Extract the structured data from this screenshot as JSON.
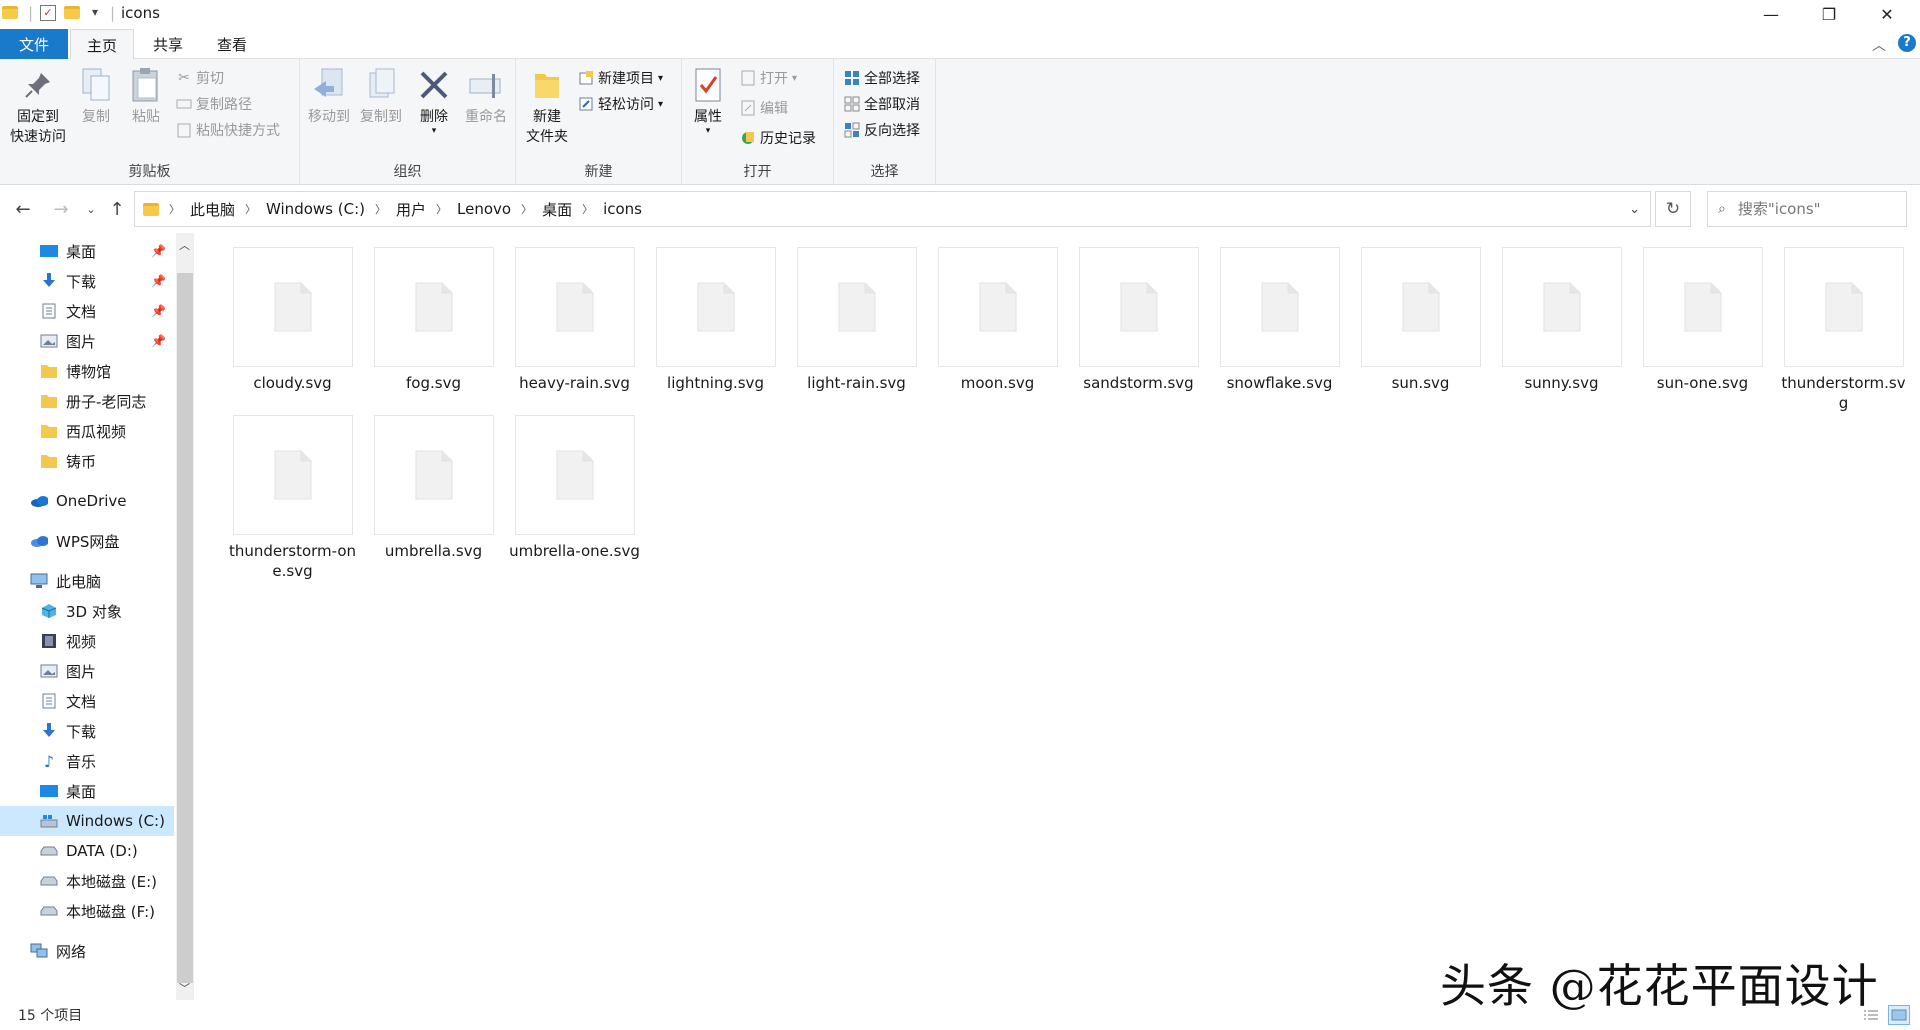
{
  "window": {
    "title": "icons",
    "minimize": "—",
    "maximize": "❐",
    "close": "✕"
  },
  "tabs": [
    {
      "label": "文件"
    },
    {
      "label": "主页"
    },
    {
      "label": "共享"
    },
    {
      "label": "查看"
    }
  ],
  "ribbon": {
    "clipboard": {
      "pin": "固定到\n快速访问",
      "pin_line1": "固定到",
      "pin_line2": "快速访问",
      "copy": "复制",
      "paste": "粘贴",
      "cut": "剪切",
      "copy_path": "复制路径",
      "paste_shortcut": "粘贴快捷方式",
      "label": "剪贴板"
    },
    "organize": {
      "move_to": "移动到",
      "copy_to": "复制到",
      "delete": "删除",
      "rename": "重命名",
      "label": "组织"
    },
    "new": {
      "new_folder_line1": "新建",
      "new_folder_line2": "文件夹",
      "new_item": "新建项目",
      "easy_access": "轻松访问",
      "label": "新建"
    },
    "open": {
      "properties": "属性",
      "open": "打开",
      "edit": "编辑",
      "history": "历史记录",
      "label": "打开"
    },
    "select": {
      "select_all": "全部选择",
      "select_none": "全部取消",
      "invert": "反向选择",
      "label": "选择"
    }
  },
  "breadcrumb": [
    "此电脑",
    "Windows (C:)",
    "用户",
    "Lenovo",
    "桌面",
    "icons"
  ],
  "search": {
    "placeholder": "搜索\"icons\""
  },
  "nav": {
    "quick": [
      {
        "label": "桌面",
        "icon": "desktop-icon"
      },
      {
        "label": "下载",
        "icon": "download-icon"
      },
      {
        "label": "文档",
        "icon": "document-icon"
      },
      {
        "label": "图片",
        "icon": "picture-icon"
      },
      {
        "label": "博物馆",
        "icon": "folder-icon"
      },
      {
        "label": "册子-老同志",
        "icon": "folder-icon"
      },
      {
        "label": "西瓜视频",
        "icon": "folder-icon"
      },
      {
        "label": "铸币",
        "icon": "folder-icon"
      }
    ],
    "onedrive": "OneDrive",
    "wps": "WPS网盘",
    "pc": "此电脑",
    "pc_items": [
      {
        "label": "3D 对象"
      },
      {
        "label": "视频"
      },
      {
        "label": "图片"
      },
      {
        "label": "文档"
      },
      {
        "label": "下载"
      },
      {
        "label": "音乐"
      },
      {
        "label": "桌面"
      },
      {
        "label": "Windows (C:)"
      },
      {
        "label": "DATA (D:)"
      },
      {
        "label": "本地磁盘 (E:)"
      },
      {
        "label": "本地磁盘 (F:)"
      }
    ],
    "network": "网络"
  },
  "files": [
    "cloudy.svg",
    "fog.svg",
    "heavy-rain.svg",
    "lightning.svg",
    "light-rain.svg",
    "moon.svg",
    "sandstorm.svg",
    "snowflake.svg",
    "sun.svg",
    "sunny.svg",
    "sun-one.svg",
    "thunderstorm.svg",
    "thunderstorm-one.svg",
    "umbrella.svg",
    "umbrella-one.svg"
  ],
  "status": {
    "count": "15 个项目"
  },
  "watermark": "头条 @花花平面设计",
  "colors": {
    "accent": "#1979ca",
    "selected": "#cce8ff"
  }
}
